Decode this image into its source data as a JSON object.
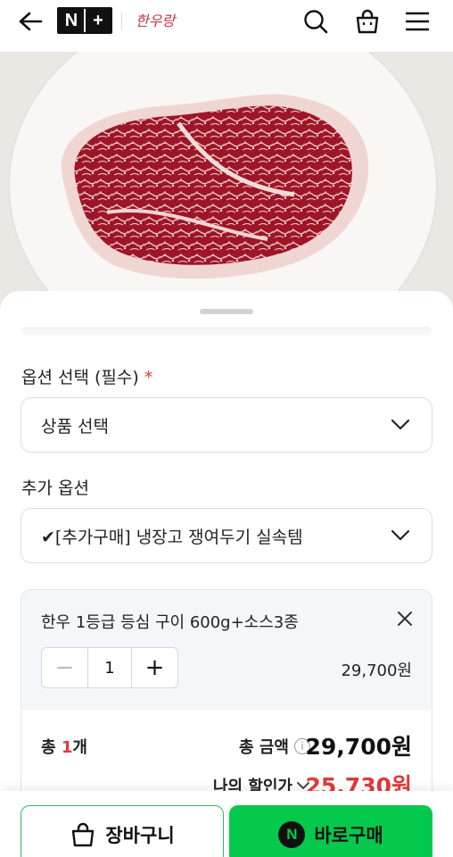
{
  "header": {
    "logo_n": "N",
    "logo_plus": "+",
    "brand": "한우랑",
    "icons": [
      "back-arrow-icon",
      "search-icon",
      "shopping-bag-icon",
      "menu-icon"
    ]
  },
  "hero": {
    "alt": "marbled beef steak on white plate"
  },
  "options": {
    "required_label": "옵션 선택 (필수)",
    "required_mark": "*",
    "product_select_value": "상품 선택",
    "extra_label": "추가 옵션",
    "extra_select_value": "✔[추가구매] 냉장고 쟁여두기 실속템"
  },
  "selected_item": {
    "name": "한우 1등급 등심 구이 600g+소스3종",
    "quantity": "1",
    "minus": "−",
    "plus": "+",
    "price": "29,700원"
  },
  "totals": {
    "count_prefix": "총 ",
    "count_num": "1",
    "count_suffix": "개",
    "total_label": "총 금액",
    "info": "i",
    "total_amount": "29,700원",
    "discount_label": "나의 할인가",
    "discount_amount": "25,730원"
  },
  "bottom": {
    "cart_label": "장바구니",
    "buy_label": "바로구매",
    "npay_mark": "N"
  },
  "colors": {
    "accent_green": "#05c94d",
    "accent_red": "#e03a3a"
  }
}
